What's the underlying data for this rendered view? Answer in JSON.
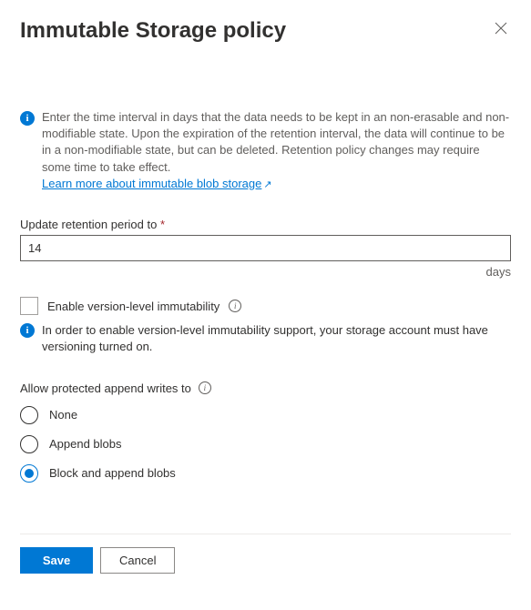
{
  "header": {
    "title": "Immutable Storage policy"
  },
  "info": {
    "text": "Enter the time interval in days that the data needs to be kept in an non-erasable and non-modifiable state. Upon the expiration of the retention interval, the data will continue to be in a non-modifiable state, but can be deleted. Retention policy changes may require some time to take effect.",
    "link_text": "Learn more about immutable blob storage"
  },
  "retention": {
    "label": "Update retention period to",
    "value": "14",
    "suffix": "days"
  },
  "version_level": {
    "checkbox_label": "Enable version-level immutability",
    "hint": "In order to enable version-level immutability support, your storage account must have versioning turned on."
  },
  "append_writes": {
    "label": "Allow protected append writes to",
    "options": {
      "none": "None",
      "append": "Append blobs",
      "block_append": "Block and append blobs"
    },
    "selected": "block_append"
  },
  "buttons": {
    "save": "Save",
    "cancel": "Cancel"
  }
}
